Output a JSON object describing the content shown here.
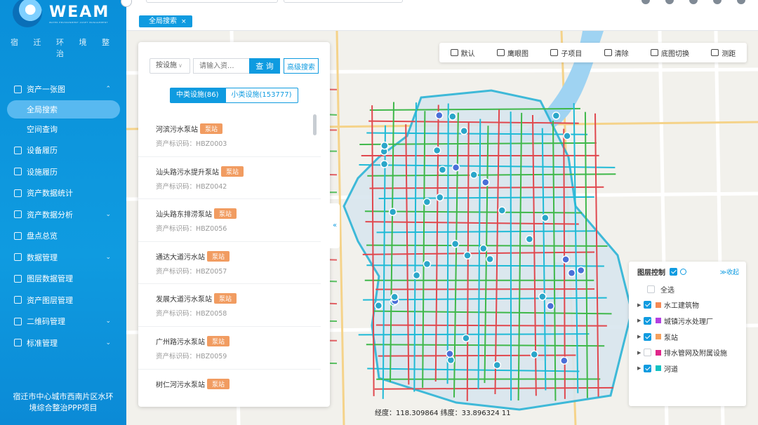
{
  "app": {
    "logo_text": "WEAM",
    "logo_sub": "WATER ENVIRONMENT ASSET MANAGEMENT",
    "org_name": "宿 迁 环 境 整 治",
    "footer": "宿迁市中心城市西南片区水环境综合整治PPP项目"
  },
  "nav": [
    {
      "label": "资产一张图",
      "icon": "map-icon",
      "chevron": "⌃",
      "type": "group"
    },
    {
      "label": "全局搜索",
      "type": "sub",
      "active": true
    },
    {
      "label": "空间查询",
      "type": "sub"
    },
    {
      "label": "设备履历",
      "icon": "device-icon",
      "type": "item"
    },
    {
      "label": "设施履历",
      "icon": "facility-icon",
      "type": "item"
    },
    {
      "label": "资产数据统计",
      "icon": "database-icon",
      "type": "item"
    },
    {
      "label": "资产数据分析",
      "icon": "analysis-icon",
      "chevron": "⌄",
      "type": "item"
    },
    {
      "label": "盘点总览",
      "icon": "inventory-icon",
      "type": "item"
    },
    {
      "label": "数据管理",
      "icon": "data-icon",
      "chevron": "⌄",
      "type": "item"
    },
    {
      "label": "图层数据管理",
      "icon": "layer-data-icon",
      "type": "item"
    },
    {
      "label": "资产图层管理",
      "icon": "asset-layer-icon",
      "type": "item"
    },
    {
      "label": "二维码管理",
      "icon": "qrcode-icon",
      "chevron": "⌄",
      "type": "item"
    },
    {
      "label": "标准管理",
      "icon": "standard-icon",
      "chevron": "⌄",
      "type": "item"
    }
  ],
  "tab": {
    "label": "全局搜索",
    "close": "×"
  },
  "toolbar": [
    {
      "label": "默认",
      "icon": "default-icon"
    },
    {
      "label": "鹰眼图",
      "icon": "eagle-eye-icon"
    },
    {
      "label": "子项目",
      "icon": "subproject-icon"
    },
    {
      "label": "清除",
      "icon": "clear-icon"
    },
    {
      "label": "底图切换",
      "icon": "basemap-icon"
    },
    {
      "label": "测距",
      "icon": "measure-icon"
    }
  ],
  "search": {
    "type_select": "按设施",
    "placeholder": "请输入资...",
    "query_label": "查 询",
    "advanced_label": "高级搜索",
    "seg_mid": "中类设施(86)",
    "seg_small": "小类设施(153777)"
  },
  "results": [
    {
      "name": "河滨污水泵站",
      "badge": "泵站",
      "code": "资产标识码：HBZ0003"
    },
    {
      "name": "汕头路污水提升泵站",
      "badge": "泵站",
      "code": "资产标识码：HBZ0042"
    },
    {
      "name": "汕头路东排涝泵站",
      "badge": "泵站",
      "code": "资产标识码：HBZ0056"
    },
    {
      "name": "通达大道污水站",
      "badge": "泵站",
      "code": "资产标识码：HBZ0057"
    },
    {
      "name": "发展大道污水泵站",
      "badge": "泵站",
      "code": "资产标识码：HBZ0058"
    },
    {
      "name": "广州路污水泵站",
      "badge": "泵站",
      "code": "资产标识码：HBZ0059"
    },
    {
      "name": "树仁河污水泵站",
      "badge": "泵站",
      "code": ""
    }
  ],
  "layers": {
    "title": "图层控制",
    "fold": "≫收起",
    "all_label": "全选",
    "items": [
      {
        "label": "水工建筑物",
        "color": "#f58a55",
        "checked": true
      },
      {
        "label": "城镇污水处理厂",
        "color": "#b43fe0",
        "checked": true
      },
      {
        "label": "泵站",
        "color": "#f5a15e",
        "checked": true
      },
      {
        "label": "排水管网及附属设施",
        "color": "#e0268a",
        "checked": false
      },
      {
        "label": "河道",
        "color": "#13c2c2",
        "checked": true
      }
    ]
  },
  "coords": {
    "text": "经度：118.309864 纬度：33.896324  11"
  },
  "colors": {
    "primary": "#0f9be0",
    "badge": "#f19c61"
  }
}
